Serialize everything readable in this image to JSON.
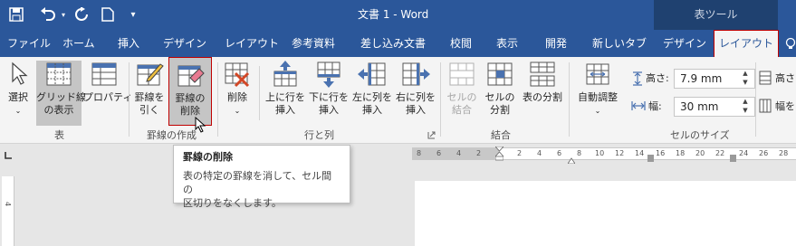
{
  "window": {
    "title": "文書 1  -  Word",
    "context_tool": "表ツール"
  },
  "qat": {
    "save_icon": "save-icon",
    "undo_icon": "undo-icon",
    "redo_icon": "repeat-icon",
    "new_icon": "new-document-icon",
    "more_icon": "customize-qat-icon"
  },
  "tabs": [
    {
      "label": "ファイル"
    },
    {
      "label": "ホーム"
    },
    {
      "label": "挿入"
    },
    {
      "label": "デザイン"
    },
    {
      "label": "レイアウト"
    },
    {
      "label": "参考資料"
    },
    {
      "label": "差し込み文書"
    },
    {
      "label": "校閲"
    },
    {
      "label": "表示"
    },
    {
      "label": "開発"
    },
    {
      "label": "新しいタブ"
    },
    {
      "label": "デザイン"
    },
    {
      "label": "レイアウト",
      "active": true
    }
  ],
  "ribbon": {
    "groups": {
      "table": "表",
      "draw": "罫線の作成",
      "rows_cols": "行と列",
      "merge": "結合",
      "cell_size": "セルのサイズ"
    },
    "buttons": {
      "select": [
        "選択",
        ""
      ],
      "gridlines": [
        "グリッド線",
        "の表示"
      ],
      "properties": [
        "プロパティ",
        ""
      ],
      "draw_table": [
        "罫線を",
        "引く"
      ],
      "eraser": [
        "罫線の",
        "削除"
      ],
      "delete": [
        "削除",
        ""
      ],
      "insert_above": [
        "上に行を",
        "挿入"
      ],
      "insert_below": [
        "下に行を",
        "挿入"
      ],
      "insert_left": [
        "左に列を",
        "挿入"
      ],
      "insert_right": [
        "右に列を",
        "挿入"
      ],
      "merge_cells": [
        "セルの",
        "結合"
      ],
      "split_cells": [
        "セルの",
        "分割"
      ],
      "split_table": [
        "表の分割",
        ""
      ],
      "autofit": [
        "自動調整",
        ""
      ]
    },
    "height_label": "高さ:",
    "height_value": "7.9 mm",
    "width_label": "幅:",
    "width_value": "30 mm",
    "dist_rows": "高さを",
    "dist_cols": "幅を"
  },
  "tooltip": {
    "title": "罫線の削除",
    "body_line1": "表の特定の罫線を消して、セル間の",
    "body_line2": "区切りをなくします。"
  },
  "ruler": {
    "numbers": [
      "8",
      "6",
      "4",
      "2",
      "2",
      "2",
      "4",
      "6",
      "8",
      "10",
      "12",
      "14",
      "16",
      "18",
      "20",
      "22",
      "24",
      "26",
      "28"
    ],
    "vertical_number": "4"
  }
}
